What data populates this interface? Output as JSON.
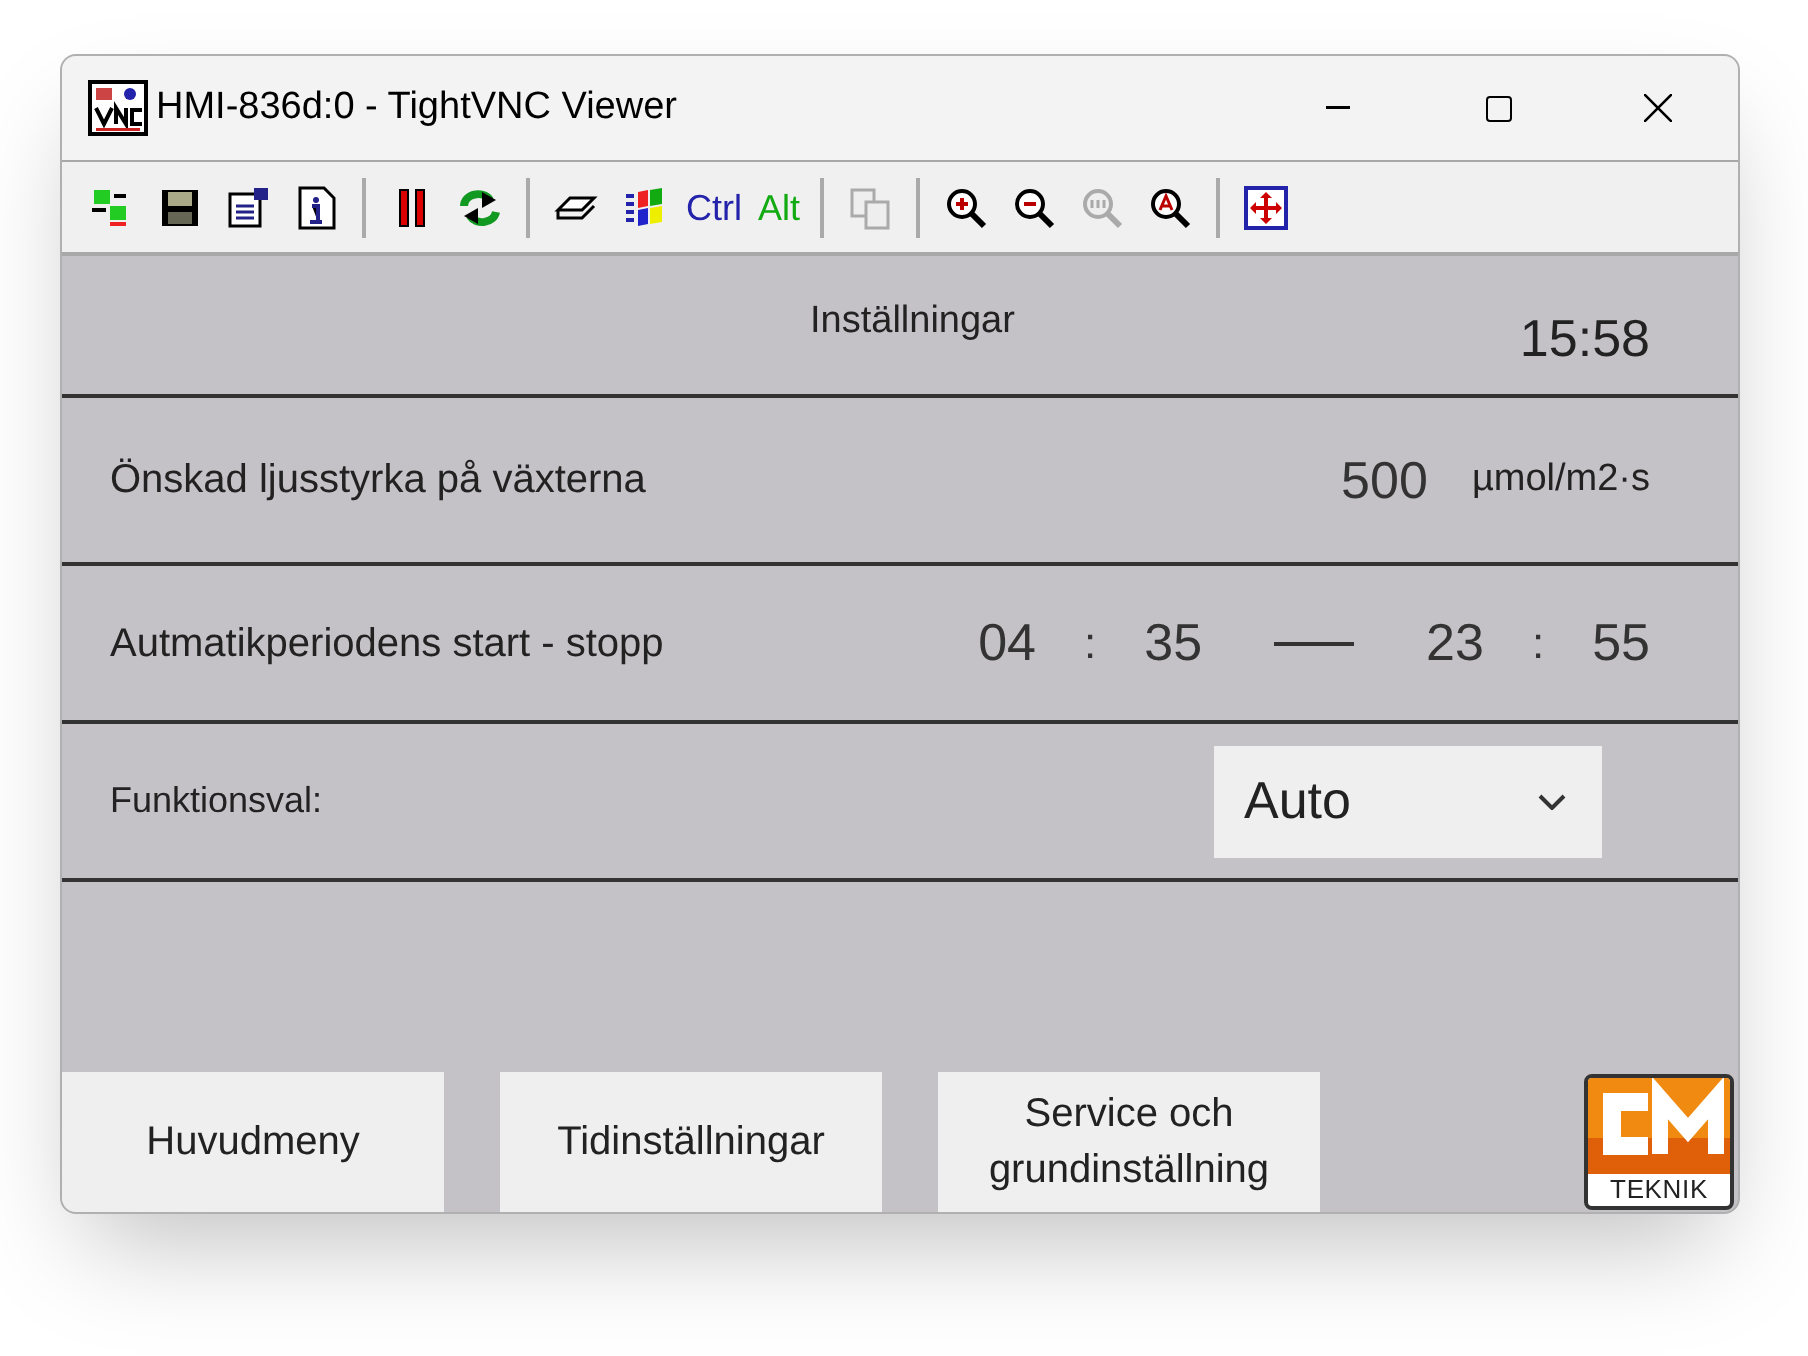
{
  "window": {
    "title": "HMI-836d:0 - TightVNC Viewer"
  },
  "toolbar": {
    "texts": [
      "Ctrl",
      "Alt"
    ]
  },
  "header": {
    "title": "Inställningar",
    "time": "15:58"
  },
  "light": {
    "label": "Önskad ljusstyrka på växterna",
    "value": "500",
    "unit": "µmol/m2·s"
  },
  "period": {
    "label": "Autmatikperiodens start - stopp",
    "start_hour": "04",
    "start_minute": "35",
    "stop_hour": "23",
    "stop_minute": "55",
    "separator": ":"
  },
  "function": {
    "label": "Funktionsval:",
    "value": "Auto"
  },
  "buttons": [
    "Huvudmeny",
    "Tidinställningar",
    "Service och grundinställning"
  ],
  "logo": {
    "caption": "TEKNIK"
  }
}
